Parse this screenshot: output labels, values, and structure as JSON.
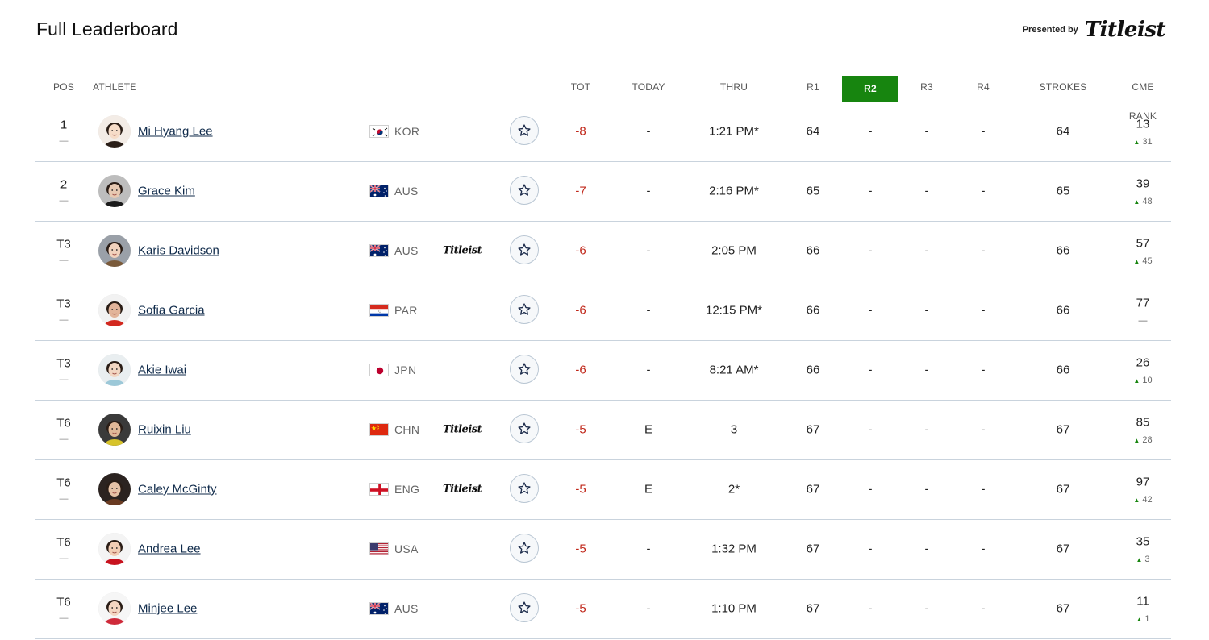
{
  "header": {
    "title": "Full Leaderboard",
    "presented_by": "Presented by",
    "sponsor_logo": "Titleist"
  },
  "columns": {
    "pos": "POS",
    "athlete": "ATHLETE",
    "tot": "TOT",
    "today": "TODAY",
    "thru": "THRU",
    "r1": "R1",
    "r2": "R2",
    "r3": "R3",
    "r4": "R4",
    "strokes": "STROKES",
    "cme_rank": "CME RANK"
  },
  "colors": {
    "active_round": "#17850f",
    "score_under_par": "#c0271a",
    "rank_up": "#17850f",
    "name_link": "#0f2a4a"
  },
  "rows": [
    {
      "pos": "1",
      "pos_move": "—",
      "name": "Mi Hyang Lee",
      "country": "KOR",
      "flag": "kor",
      "sponsor": "",
      "tot": "-8",
      "today": "-",
      "thru": "1:21 PM*",
      "r1": "64",
      "r2": "-",
      "r3": "-",
      "r4": "-",
      "strokes": "64",
      "cme_rank": "13",
      "cme_change": "31",
      "cme_dir": "up"
    },
    {
      "pos": "2",
      "pos_move": "—",
      "name": "Grace Kim",
      "country": "AUS",
      "flag": "aus",
      "sponsor": "",
      "tot": "-7",
      "today": "-",
      "thru": "2:16 PM*",
      "r1": "65",
      "r2": "-",
      "r3": "-",
      "r4": "-",
      "strokes": "65",
      "cme_rank": "39",
      "cme_change": "48",
      "cme_dir": "up"
    },
    {
      "pos": "T3",
      "pos_move": "—",
      "name": "Karis Davidson",
      "country": "AUS",
      "flag": "aus",
      "sponsor": "Titleist",
      "tot": "-6",
      "today": "-",
      "thru": "2:05 PM",
      "r1": "66",
      "r2": "-",
      "r3": "-",
      "r4": "-",
      "strokes": "66",
      "cme_rank": "57",
      "cme_change": "45",
      "cme_dir": "up"
    },
    {
      "pos": "T3",
      "pos_move": "—",
      "name": "Sofia Garcia",
      "country": "PAR",
      "flag": "par",
      "sponsor": "",
      "tot": "-6",
      "today": "-",
      "thru": "12:15 PM*",
      "r1": "66",
      "r2": "-",
      "r3": "-",
      "r4": "-",
      "strokes": "66",
      "cme_rank": "77",
      "cme_change": "—",
      "cme_dir": "none"
    },
    {
      "pos": "T3",
      "pos_move": "—",
      "name": "Akie Iwai",
      "country": "JPN",
      "flag": "jpn",
      "sponsor": "",
      "tot": "-6",
      "today": "-",
      "thru": "8:21 AM*",
      "r1": "66",
      "r2": "-",
      "r3": "-",
      "r4": "-",
      "strokes": "66",
      "cme_rank": "26",
      "cme_change": "10",
      "cme_dir": "up"
    },
    {
      "pos": "T6",
      "pos_move": "—",
      "name": "Ruixin Liu",
      "country": "CHN",
      "flag": "chn",
      "sponsor": "Titleist",
      "tot": "-5",
      "today": "E",
      "thru": "3",
      "r1": "67",
      "r2": "-",
      "r3": "-",
      "r4": "-",
      "strokes": "67",
      "cme_rank": "85",
      "cme_change": "28",
      "cme_dir": "up"
    },
    {
      "pos": "T6",
      "pos_move": "—",
      "name": "Caley McGinty",
      "country": "ENG",
      "flag": "eng",
      "sponsor": "Titleist",
      "tot": "-5",
      "today": "E",
      "thru": "2*",
      "r1": "67",
      "r2": "-",
      "r3": "-",
      "r4": "-",
      "strokes": "67",
      "cme_rank": "97",
      "cme_change": "42",
      "cme_dir": "up"
    },
    {
      "pos": "T6",
      "pos_move": "—",
      "name": "Andrea Lee",
      "country": "USA",
      "flag": "usa",
      "sponsor": "",
      "tot": "-5",
      "today": "-",
      "thru": "1:32 PM",
      "r1": "67",
      "r2": "-",
      "r3": "-",
      "r4": "-",
      "strokes": "67",
      "cme_rank": "35",
      "cme_change": "3",
      "cme_dir": "up"
    },
    {
      "pos": "T6",
      "pos_move": "—",
      "name": "Minjee Lee",
      "country": "AUS",
      "flag": "aus",
      "sponsor": "",
      "tot": "-5",
      "today": "-",
      "thru": "1:10 PM",
      "r1": "67",
      "r2": "-",
      "r3": "-",
      "r4": "-",
      "strokes": "67",
      "cme_rank": "11",
      "cme_change": "1",
      "cme_dir": "up"
    }
  ]
}
